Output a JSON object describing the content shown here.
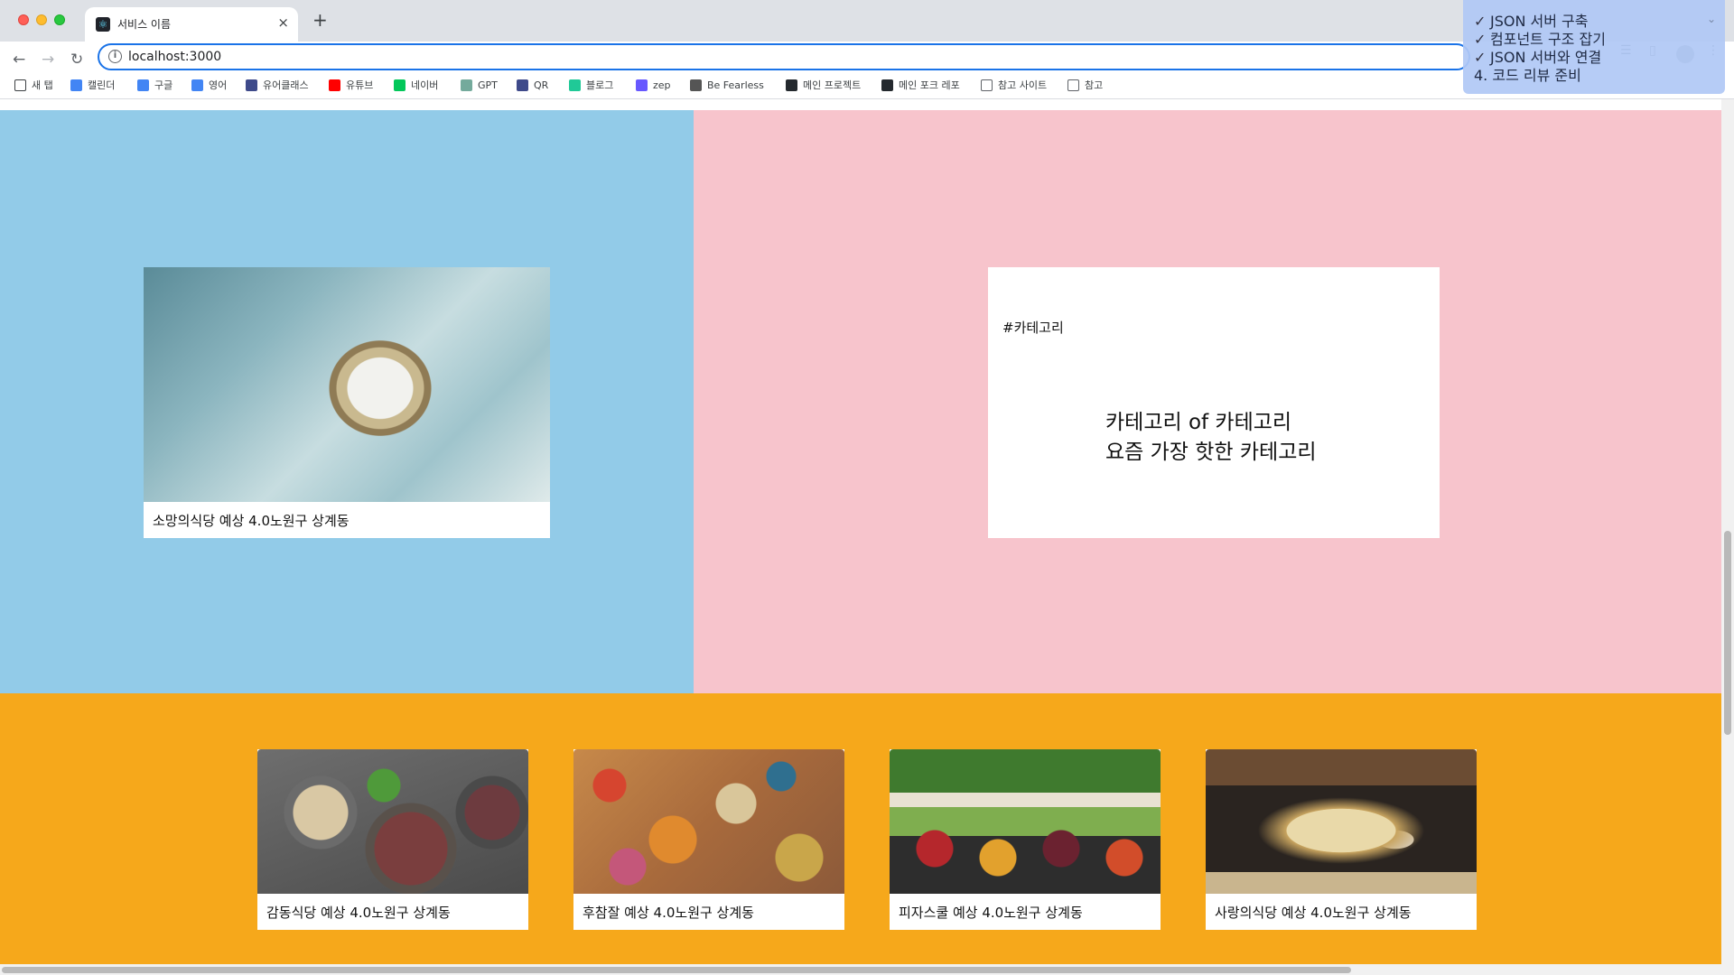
{
  "browser": {
    "tab_title": "서비스 이름",
    "tab_close": "×",
    "new_tab": "+",
    "url": "localhost:3000",
    "back": "←",
    "forward": "→",
    "reload": "↻",
    "info": "i"
  },
  "bookmarks": [
    {
      "label": "새 탭",
      "icon": "page-icon",
      "color": "#3c4043"
    },
    {
      "label": "캘린더",
      "icon": "calendar-icon",
      "color": "#4285f4"
    },
    {
      "label": "구글",
      "icon": "google-icon",
      "color": "#4285f4"
    },
    {
      "label": "영어",
      "icon": "google-icon",
      "color": "#4285f4"
    },
    {
      "label": "유어클래스",
      "icon": "codestates-icon",
      "color": "#3e4a8a"
    },
    {
      "label": "유튜브",
      "icon": "youtube-icon",
      "color": "#ff0000"
    },
    {
      "label": "네이버",
      "icon": "naver-icon",
      "color": "#03c75a"
    },
    {
      "label": "GPT",
      "icon": "openai-icon",
      "color": "#74aa9c"
    },
    {
      "label": "QR",
      "icon": "codestates-icon",
      "color": "#3e4a8a"
    },
    {
      "label": "블로그",
      "icon": "velog-icon",
      "color": "#20c997"
    },
    {
      "label": "zep",
      "icon": "zep-icon",
      "color": "#6758ff"
    },
    {
      "label": "Be Fearless",
      "icon": "eye-icon",
      "color": "#555555"
    },
    {
      "label": "메인 프로젝트",
      "icon": "github-icon",
      "color": "#24292e"
    },
    {
      "label": "메인 포크 레포",
      "icon": "github-icon",
      "color": "#24292e"
    },
    {
      "label": "참고 사이트",
      "icon": "folder-icon",
      "color": "#5f6368"
    },
    {
      "label": "참고",
      "icon": "folder-icon",
      "color": "#5f6368"
    }
  ],
  "checklist": [
    {
      "mark": "✓",
      "text": "JSON 서버 구축"
    },
    {
      "mark": "✓",
      "text": "컴포넌트 구조 잡기"
    },
    {
      "mark": "✓",
      "text": "JSON 서버와 연결"
    },
    {
      "mark": "",
      "text": "4. 코드 리뷰 준비"
    }
  ],
  "colors": {
    "blue_panel": "#92cbe8",
    "pink_panel": "#f7c4cc",
    "orange_panel": "#f6a81b"
  },
  "feature": {
    "caption": "소망의식당   예상 4.0노원구 상계동"
  },
  "category": {
    "tag": "#카테고리",
    "title_line1": "카테고리 of 카테고리",
    "title_line2": "요즘 가장 핫한 카테고리"
  },
  "restaurants": [
    {
      "caption": "감동식당   예상 4.0노원구 상계동"
    },
    {
      "caption": "후참잘   예상 4.0노원구 상계동"
    },
    {
      "caption": "피자스쿨   예상 4.0노원구 상계동"
    },
    {
      "caption": "사랑의식당   예상 4.0노원구 상계동"
    }
  ]
}
